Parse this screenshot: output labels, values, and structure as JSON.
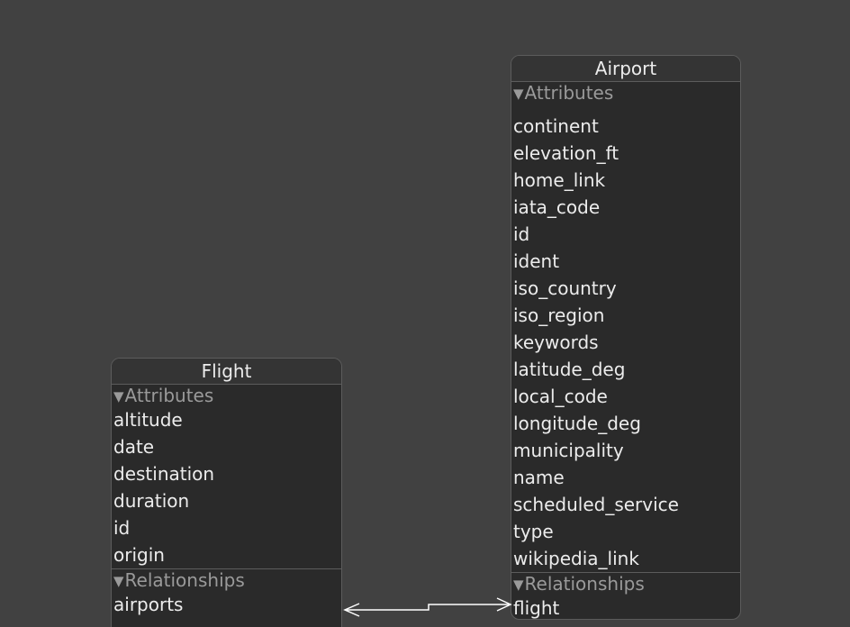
{
  "airport": {
    "title": "Airport",
    "attributes_header": "Attributes",
    "attributes": [
      "continent",
      "elevation_ft",
      "home_link",
      "iata_code",
      "id",
      "ident",
      "iso_country",
      "iso_region",
      "keywords",
      "latitude_deg",
      "local_code",
      "longitude_deg",
      "municipality",
      "name",
      "scheduled_service",
      "type",
      "wikipedia_link"
    ],
    "relationships_header": "Relationships",
    "relationships": [
      "flight"
    ]
  },
  "flight": {
    "title": "Flight",
    "attributes_header": "Attributes",
    "attributes": [
      "altitude",
      "date",
      "destination",
      "duration",
      "id",
      "origin"
    ],
    "relationships_header": "Relationships",
    "relationships": [
      "airports"
    ]
  },
  "colors": {
    "canvas": "#414141",
    "entity_body": "#2a2a2a",
    "text": "#ececec",
    "section_header": "#9a9a9a",
    "connector": "#ffffff"
  }
}
